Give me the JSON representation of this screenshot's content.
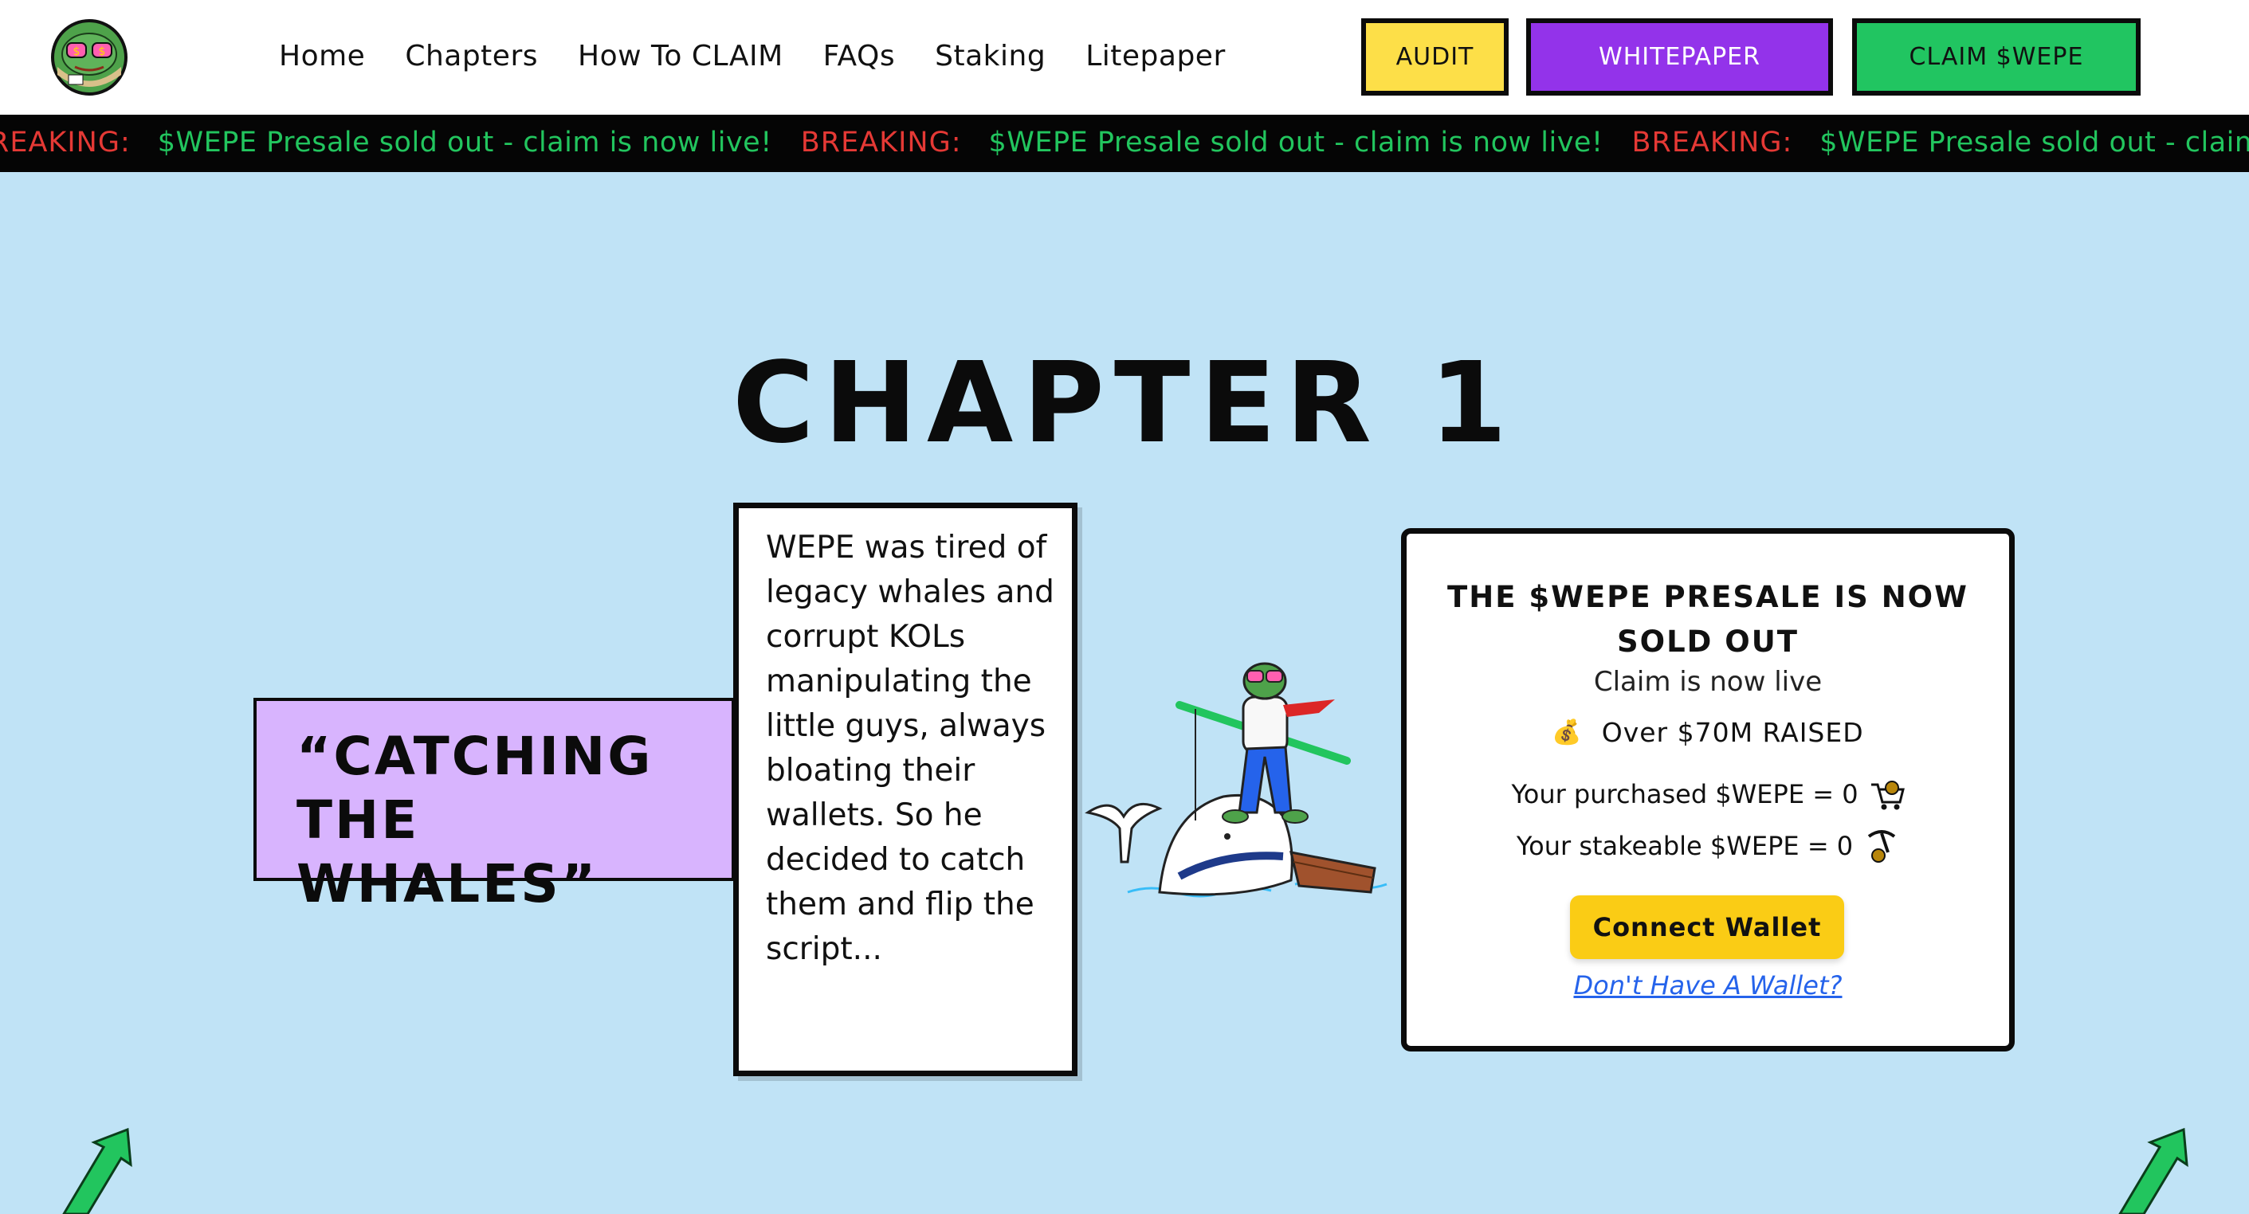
{
  "nav": {
    "items": [
      {
        "label": "Home"
      },
      {
        "label": "Chapters"
      },
      {
        "label": "How To CLAIM"
      },
      {
        "label": "FAQs"
      },
      {
        "label": "Staking"
      },
      {
        "label": "Litepaper"
      }
    ]
  },
  "header_buttons": {
    "audit": "AUDIT",
    "whitepaper": "WHITEPAPER",
    "claim": "CLAIM $WEPE"
  },
  "ticker": {
    "tag": "BREAKING:",
    "message": "$WEPE Presale sold out - claim is now live!"
  },
  "chapter": {
    "title": "CHAPTER 1",
    "quote": "“CATCHING THE WHALES”",
    "story": "WEPE was tired of legacy whales and corrupt KOLs manipulating the little guys, always bloating their wallets. So he decided to catch them and flip the script..."
  },
  "presale_card": {
    "title": "THE $WEPE PRESALE IS NOW SOLD OUT",
    "subtitle": "Claim is now live",
    "raised": "Over $70M RAISED",
    "purchased": "Your purchased $WEPE = 0",
    "stakeable": "Your stakeable $WEPE = 0",
    "connect_button": "Connect Wallet",
    "no_wallet_link": "Don't Have A Wallet?"
  },
  "colors": {
    "page_bg": "#c0e3f6",
    "audit_btn": "#fddf48",
    "whitepaper_btn": "#9333ea",
    "claim_btn": "#21c561",
    "ticker_tag": "#e53935",
    "ticker_msg": "#22c55e",
    "quote_bg": "#d8b4fe",
    "connect_btn": "#facc15",
    "link": "#2563eb"
  },
  "icons": {
    "logo": "frog-logo-icon",
    "raised": "money-bag-icon",
    "purchased": "shopping-cart-icon",
    "stakeable": "pickaxe-coin-icon"
  }
}
